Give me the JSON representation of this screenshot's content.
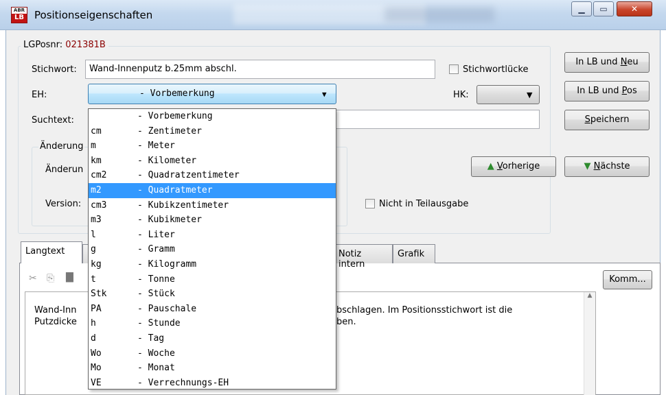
{
  "window": {
    "title": "Positionseigenschaften",
    "icon_top": "ABR",
    "icon_bottom": "LB"
  },
  "group": {
    "label": "LGPosnr:",
    "value": "021381B"
  },
  "fields": {
    "stichwort_label": "Stichwort:",
    "stichwort_value": "Wand-Innenputz b.25mm abschl.",
    "stichwortluecke_label": "Stichwortlücke",
    "eh_label": "EH:",
    "eh_selected": "- Vorbemerkung",
    "hk_label": "HK:",
    "suchtext_label": "Suchtext:",
    "aenderung_group_label": "Änderung",
    "aenderung_label": "Änderun",
    "version_label": "Version:",
    "nicht_teilausgabe_label": "Nicht in Teilausgabe"
  },
  "buttons": {
    "in_lb_neu_prefix": "In LB und ",
    "in_lb_neu_ul": "N",
    "in_lb_neu_suffix": "eu",
    "in_lb_pos_prefix": "In LB und ",
    "in_lb_pos_ul": "P",
    "in_lb_pos_suffix": "os",
    "speichern_ul": "S",
    "speichern_suffix": "peichern",
    "vorherige_ul": "V",
    "vorherige_suffix": "orherige",
    "naechste_ul": "N",
    "naechste_suffix": "ächste",
    "komm": "Komm..."
  },
  "tabs": [
    {
      "label": "Langtext",
      "active": true
    },
    {
      "label": "Notiz intern",
      "active": false
    },
    {
      "label": "Grafik",
      "active": false
    }
  ],
  "editor": {
    "line1_left": "Wand-Inn",
    "line1_right": "bschlagen. Im Positionsstichwort ist die",
    "line2_left": "Putzdicke",
    "line2_right": "ben."
  },
  "dropdown": {
    "items": [
      {
        "code": "",
        "name": "- Vorbemerkung"
      },
      {
        "code": "cm",
        "name": "- Zentimeter"
      },
      {
        "code": "m",
        "name": "- Meter"
      },
      {
        "code": "km",
        "name": "- Kilometer"
      },
      {
        "code": "cm2",
        "name": "- Quadratzentimeter"
      },
      {
        "code": "m2",
        "name": "- Quadratmeter"
      },
      {
        "code": "cm3",
        "name": "- Kubikzentimeter"
      },
      {
        "code": "m3",
        "name": "- Kubikmeter"
      },
      {
        "code": "l",
        "name": "- Liter"
      },
      {
        "code": "g",
        "name": "- Gramm"
      },
      {
        "code": "kg",
        "name": "- Kilogramm"
      },
      {
        "code": "t",
        "name": "- Tonne"
      },
      {
        "code": "Stk",
        "name": "- Stück"
      },
      {
        "code": "PA",
        "name": "- Pauschale"
      },
      {
        "code": "h",
        "name": "- Stunde"
      },
      {
        "code": "d",
        "name": "- Tag"
      },
      {
        "code": "Wo",
        "name": "- Woche"
      },
      {
        "code": "Mo",
        "name": "- Monat"
      },
      {
        "code": "VE",
        "name": "- Verrechnungs-EH"
      }
    ],
    "highlighted_code": "m2"
  },
  "colors": {
    "selection": "#3399ff",
    "lgposnr_value": "#8b0000",
    "arrow_green": "#2e8b2e"
  }
}
